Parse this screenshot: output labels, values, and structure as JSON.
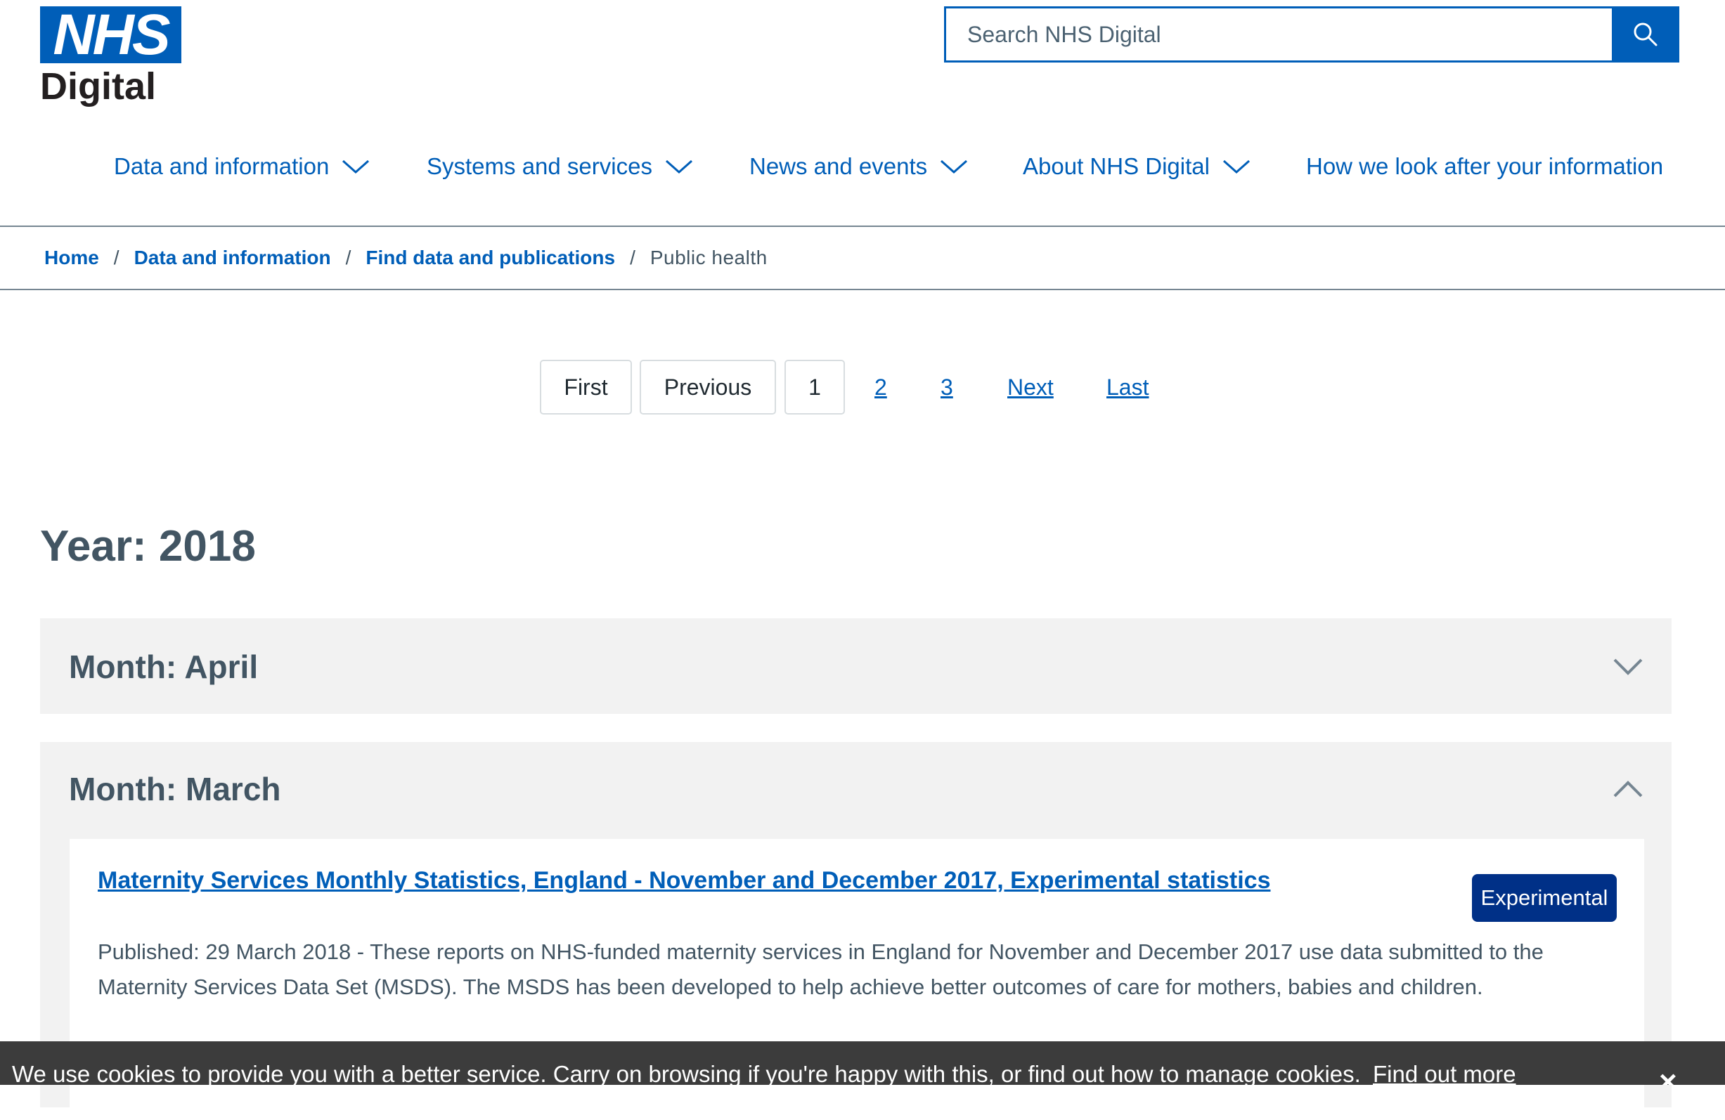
{
  "header": {
    "logo_text": "NHS",
    "logo_subtitle": "Digital",
    "search_placeholder": "Search NHS Digital"
  },
  "nav": {
    "items": [
      {
        "label": "Data and information",
        "has_dropdown": true
      },
      {
        "label": "Systems and services",
        "has_dropdown": true
      },
      {
        "label": "News and events",
        "has_dropdown": true
      },
      {
        "label": "About NHS Digital",
        "has_dropdown": true
      },
      {
        "label": "How we look after your information",
        "has_dropdown": false
      }
    ]
  },
  "breadcrumb": {
    "items": [
      "Home",
      "Data and information",
      "Find data and publications"
    ],
    "separator": "/",
    "current": "Public health"
  },
  "pagination": {
    "first": "First",
    "previous": "Previous",
    "current_page": "1",
    "pages": [
      "2",
      "3"
    ],
    "next": "Next",
    "last": "Last"
  },
  "main": {
    "year_heading": "Year: 2018",
    "months": [
      {
        "title": "Month: April",
        "expanded": false
      },
      {
        "title": "Month: March",
        "expanded": true,
        "publications": [
          {
            "title": "Maternity Services Monthly Statistics, England - November and December 2017, Experimental statistics",
            "badge": "Experimental",
            "description": "Published: 29 March 2018 - These reports on NHS-funded maternity services in England for November and December 2017 use data submitted to the Maternity Services Data Set (MSDS). The MSDS has been developed to help achieve better outcomes of care for mothers, babies and children."
          }
        ]
      }
    ]
  },
  "cookie_banner": {
    "text": "We use cookies to provide you with a better service. Carry on browsing if you're happy with this, or find out how to manage cookies.",
    "link": "Find out more",
    "close": "×"
  },
  "colors": {
    "brand_blue": "#005eb8",
    "dark_blue": "#003087",
    "text_grey": "#425563",
    "panel_grey": "#f2f2f2",
    "cookie_bg": "#3c3c3c"
  },
  "icons": {
    "search": "search-icon",
    "nav_dropdown": "chevron-down-icon",
    "collapsed": "chevron-down-icon",
    "expanded": "chevron-up-icon",
    "close": "close-icon"
  }
}
